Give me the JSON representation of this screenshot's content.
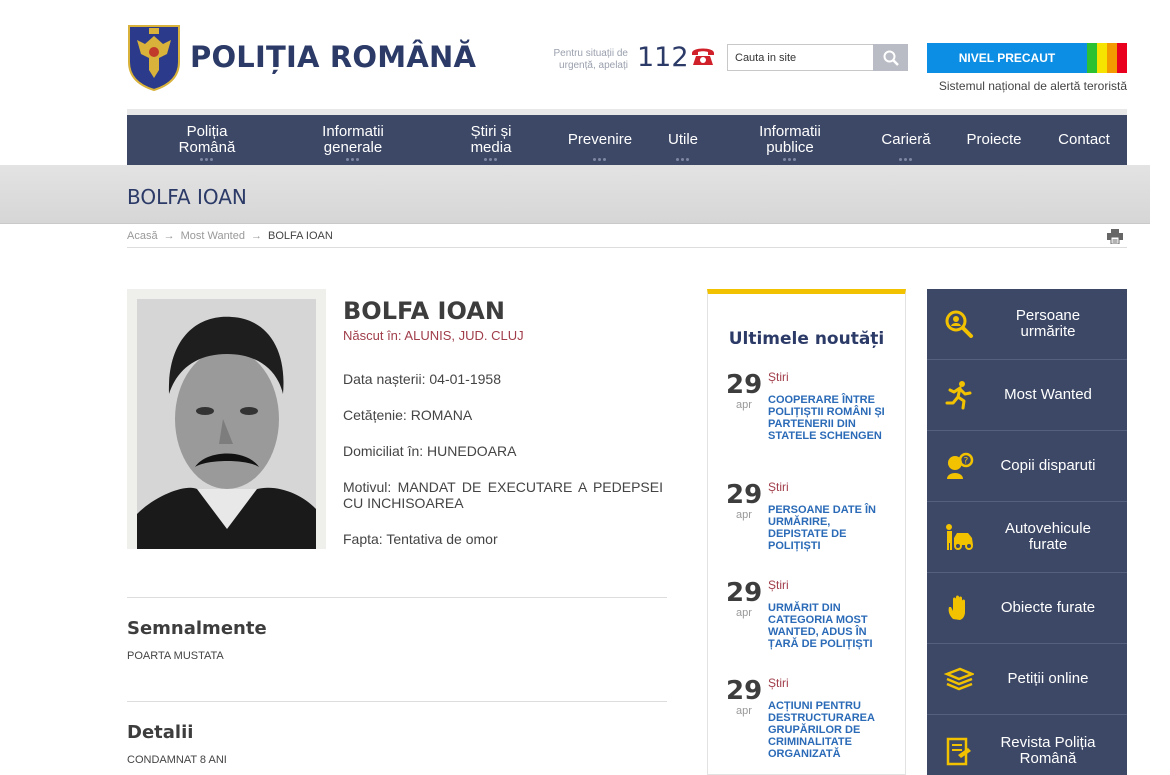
{
  "header": {
    "brand": "POLIȚIA ROMÂNĂ",
    "emergency_text": "Pentru situații de urgență, apelați",
    "emergency_number": "112",
    "search_placeholder": "Cauta in site",
    "alert_level": "NIVEL PRECAUT",
    "alert_subtitle": "Sistemul național de alertă teroristă",
    "alert_colors": [
      "#0b8ee4",
      "#2bc131",
      "#f6e400",
      "#f39a00",
      "#e8001e"
    ]
  },
  "nav": [
    {
      "label": "Poliția\nRomână"
    },
    {
      "label": "Informatii\ngenerale"
    },
    {
      "label": "Știri și\nmedia"
    },
    {
      "label": "Prevenire"
    },
    {
      "label": "Utile"
    },
    {
      "label": "Informatii\npublice"
    },
    {
      "label": "Carieră"
    },
    {
      "label": "Proiecte"
    },
    {
      "label": "Contact"
    }
  ],
  "page_title": "BOLFA IOAN",
  "breadcrumb": {
    "home": "Acasă",
    "section": "Most Wanted",
    "current": "BOLFA IOAN"
  },
  "profile": {
    "name": "BOLFA IOAN",
    "born": "Născut în: ALUNIS, JUD. CLUJ",
    "birth_date": "Data nașterii: 04-01-1958",
    "citizenship": "Cetățenie: ROMANA",
    "residence": "Domiciliat în: HUNEDOARA",
    "reason": "Motivul: MANDAT DE EXECUTARE A PEDEPSEI CU INCHISOAREA",
    "deed": "Fapta: Tentativa de omor"
  },
  "sections": {
    "marks_title": "Semnalmente",
    "marks_text": "POARTA MUSTATA",
    "details_title": "Detalii",
    "details_text": "CONDAMNAT 8 ANI"
  },
  "news": {
    "title": "Ultimele noutăți",
    "items": [
      {
        "day": "29",
        "month": "apr",
        "category": "Știri",
        "headline": "COOPERARE ÎNTRE POLIȚIȘTII ROMÂNI ȘI PARTENERII DIN STATELE SCHENGEN"
      },
      {
        "day": "29",
        "month": "apr",
        "category": "Știri",
        "headline": "PERSOANE DATE ÎN URMĂRIRE, DEPISTATE DE POLIȚIȘTI"
      },
      {
        "day": "29",
        "month": "apr",
        "category": "Știri",
        "headline": "URMĂRIT DIN CATEGORIA MOST WANTED, ADUS ÎN ȚARĂ DE POLIȚIȘTI"
      },
      {
        "day": "29",
        "month": "apr",
        "category": "Știri",
        "headline": "ACȚIUNI PENTRU DESTRUCTURAREA GRUPĂRILOR DE CRIMINALITATE ORGANIZATĂ"
      }
    ]
  },
  "side_menu": [
    {
      "label": "Persoane\nurmărite",
      "icon": "search-person-icon"
    },
    {
      "label": "Most Wanted",
      "icon": "running-man-icon"
    },
    {
      "label": "Copii disparuti",
      "icon": "child-icon"
    },
    {
      "label": "Autovehicule\nfurate",
      "icon": "car-thief-icon"
    },
    {
      "label": "Obiecte furate",
      "icon": "hand-icon"
    },
    {
      "label": "Petiții online",
      "icon": "documents-icon"
    },
    {
      "label": "Revista Poliția\nRomână",
      "icon": "magazine-icon"
    }
  ]
}
